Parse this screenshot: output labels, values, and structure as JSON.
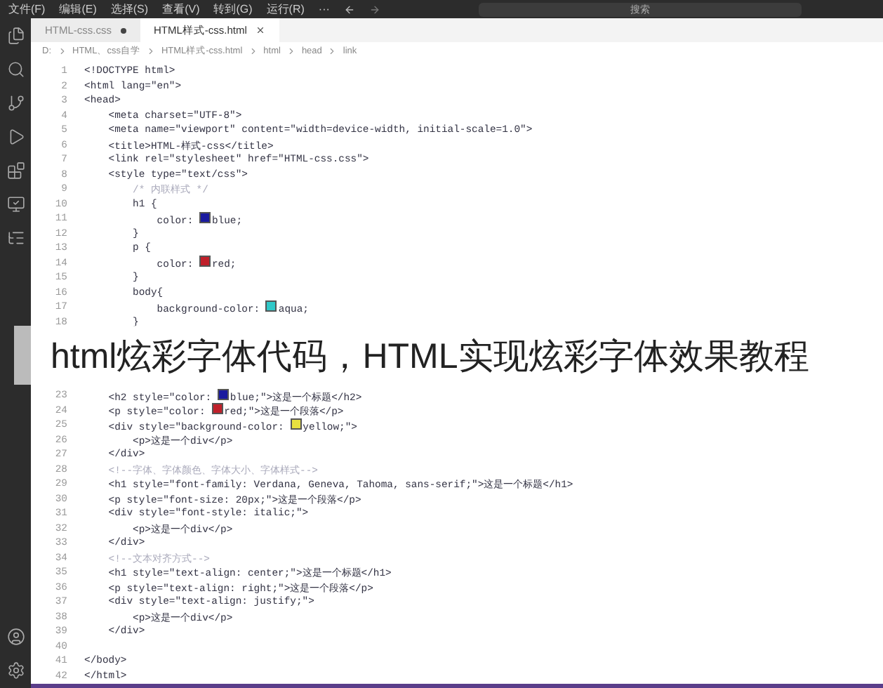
{
  "menu_bar": {
    "items": [
      "文件(F)",
      "编辑(E)",
      "选择(S)",
      "查看(V)",
      "转到(G)",
      "运行(R)",
      "···"
    ],
    "search": {
      "placeholder": "搜索"
    }
  },
  "tabs": [
    {
      "label": "HTML-css.css",
      "selected": false,
      "modified": true
    },
    {
      "label": "HTML样式-css.html",
      "selected": true,
      "modified": false
    }
  ],
  "breadcrumb": [
    "D:",
    "HTML、css自学",
    "HTML样式-css.html",
    "html",
    "head",
    "link"
  ],
  "code_top": [
    {
      "number": "1",
      "kind": "code",
      "text": "<!DOCTYPE html>"
    },
    {
      "number": "2",
      "kind": "code",
      "text": "<html lang=\"en\">"
    },
    {
      "number": "3",
      "kind": "code",
      "text": "<head>"
    },
    {
      "number": "4",
      "kind": "code",
      "text": "    <meta charset=\"UTF-8\">"
    },
    {
      "number": "5",
      "kind": "code",
      "text": "    <meta name=\"viewport\" content=\"width=device-width, initial-scale=1.0\">"
    },
    {
      "number": "6",
      "kind": "code",
      "text": "    <title>HTML-样式-css</title>"
    },
    {
      "number": "7",
      "kind": "code",
      "text": "    <link rel=\"stylesheet\" href=\"HTML-css.css\">"
    },
    {
      "number": "8",
      "kind": "code",
      "text": "    <style type=\"text/css\">"
    },
    {
      "number": "9",
      "kind": "comment",
      "text": "        /* 内联样式 */"
    },
    {
      "number": "10",
      "kind": "code",
      "text": "        h1 {"
    },
    {
      "number": "11",
      "kind": "code",
      "text": "            color: ",
      "color": "#1a1a9e",
      "after": "blue;"
    },
    {
      "number": "12",
      "kind": "code",
      "text": "        }"
    },
    {
      "number": "13",
      "kind": "code",
      "text": "        p {"
    },
    {
      "number": "14",
      "kind": "code",
      "text": "            color: ",
      "color": "#c0202a",
      "after": "red;"
    },
    {
      "number": "15",
      "kind": "code",
      "text": "        }"
    },
    {
      "number": "16",
      "kind": "code",
      "text": "        body{"
    },
    {
      "number": "17",
      "kind": "code",
      "text": "            background-color: ",
      "color": "#30c8c8",
      "after": "aqua;"
    },
    {
      "number": "18",
      "kind": "code",
      "text": "        }"
    }
  ],
  "banner": {
    "title": "html炫彩字体代码，HTML实现炫彩字体效果教程"
  },
  "code_bottom": [
    {
      "number": "23",
      "kind": "code",
      "text": "    <h2 style=\"color: ",
      "color": "#1a1a9e",
      "after": "blue;\">这是一个标题</h2>"
    },
    {
      "number": "24",
      "kind": "code",
      "text": "    <p style=\"color: ",
      "color": "#c0202a",
      "after": "red;\">这是一个段落</p>"
    },
    {
      "number": "25",
      "kind": "code",
      "text": "    <div style=\"background-color: ",
      "color": "#e8e040",
      "after": "yellow;\">"
    },
    {
      "number": "26",
      "kind": "code",
      "text": "        <p>这是一个div</p>"
    },
    {
      "number": "27",
      "kind": "code",
      "text": "    </div>"
    },
    {
      "number": "28",
      "kind": "comment",
      "text": "    <!--字体、字体颜色、字体大小、字体样式-->"
    },
    {
      "number": "29",
      "kind": "code",
      "text": "    <h1 style=\"font-family: Verdana, Geneva, Tahoma, sans-serif;\">这是一个标题</h1>"
    },
    {
      "number": "30",
      "kind": "code",
      "text": "    <p style=\"font-size: 20px;\">这是一个段落</p>"
    },
    {
      "number": "31",
      "kind": "code",
      "text": "    <div style=\"font-style: italic;\">"
    },
    {
      "number": "32",
      "kind": "code",
      "text": "        <p>这是一个div</p>"
    },
    {
      "number": "33",
      "kind": "code",
      "text": "    </div>"
    },
    {
      "number": "34",
      "kind": "comment",
      "text": "    <!--文本对齐方式-->"
    },
    {
      "number": "35",
      "kind": "code",
      "text": "    <h1 style=\"text-align: center;\">这是一个标题</h1>"
    },
    {
      "number": "36",
      "kind": "code",
      "text": "    <p style=\"text-align: right;\">这是一个段落</p>"
    },
    {
      "number": "37",
      "kind": "code",
      "text": "    <div style=\"text-align: justify;\">"
    },
    {
      "number": "38",
      "kind": "code",
      "text": "        <p>这是一个div</p>"
    },
    {
      "number": "39",
      "kind": "code",
      "text": "    </div>"
    },
    {
      "number": "40"
    },
    {
      "number": "41",
      "kind": "code",
      "text": "</body>"
    },
    {
      "number": "42",
      "kind": "code",
      "text": "</html>"
    }
  ]
}
